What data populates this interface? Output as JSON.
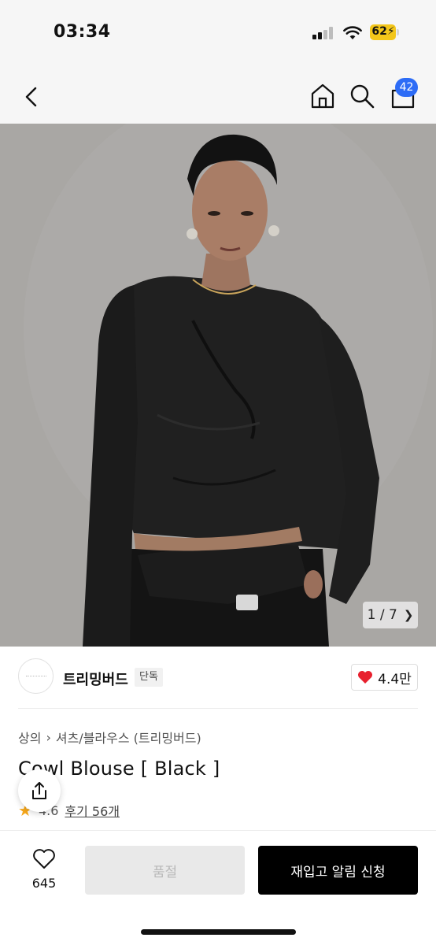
{
  "status": {
    "time": "03:34",
    "battery": "62"
  },
  "nav": {
    "cart_count": "42"
  },
  "gallery": {
    "current": "1",
    "separator": "/",
    "total": "7"
  },
  "brand": {
    "name": "트리밍버드",
    "tag": "단독",
    "likes": "4.4만"
  },
  "breadcrumb": {
    "category": "상의",
    "subcategory": "셔츠/블라우스 (트리밍버드)"
  },
  "product": {
    "title": "Cowl Blouse [ Black ]",
    "rating": "4.6",
    "reviews": "후기 56개"
  },
  "bottom": {
    "wish_count": "645",
    "soldout_label": "품절",
    "notify_label": "재입고 알림 신청"
  },
  "colors": {
    "accent_badge": "#2d6cf6",
    "like_heart": "#e8202e",
    "star": "#f7a81b",
    "cta": "#000000"
  }
}
